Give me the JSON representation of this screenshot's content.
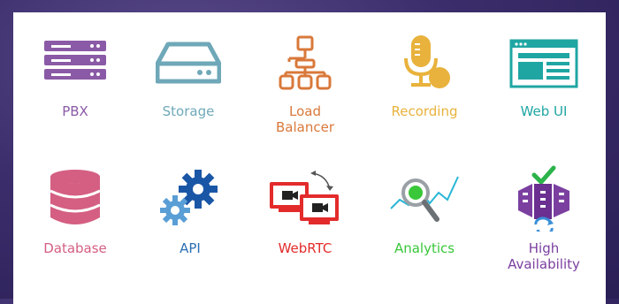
{
  "features": [
    {
      "id": "pbx",
      "label": "PBX",
      "icon": "server-rack-icon",
      "color": "#8b5aa6"
    },
    {
      "id": "storage",
      "label": "Storage",
      "icon": "storage-drive-icon",
      "color": "#6fa8b8"
    },
    {
      "id": "load_balancer",
      "label": "Load\nBalancer",
      "icon": "network-hierarchy-icon",
      "color": "#d9783a"
    },
    {
      "id": "recording",
      "label": "Recording",
      "icon": "microphone-icon",
      "color": "#e8b23c"
    },
    {
      "id": "web_ui",
      "label": "Web UI",
      "icon": "browser-window-icon",
      "color": "#1fa6a3"
    },
    {
      "id": "database",
      "label": "Database",
      "icon": "database-icon",
      "color": "#d45f82"
    },
    {
      "id": "api",
      "label": "API",
      "icon": "gears-icon",
      "color": "#2c6fb3"
    },
    {
      "id": "webrtc",
      "label": "WebRTC",
      "icon": "video-screens-icon",
      "color": "#e32b2b"
    },
    {
      "id": "analytics",
      "label": "Analytics",
      "icon": "magnifier-chart-icon",
      "color": "#3ac73a"
    },
    {
      "id": "high_availability",
      "label": "High\nAvailability",
      "icon": "server-cluster-icon",
      "color": "#7b3fa0"
    }
  ]
}
